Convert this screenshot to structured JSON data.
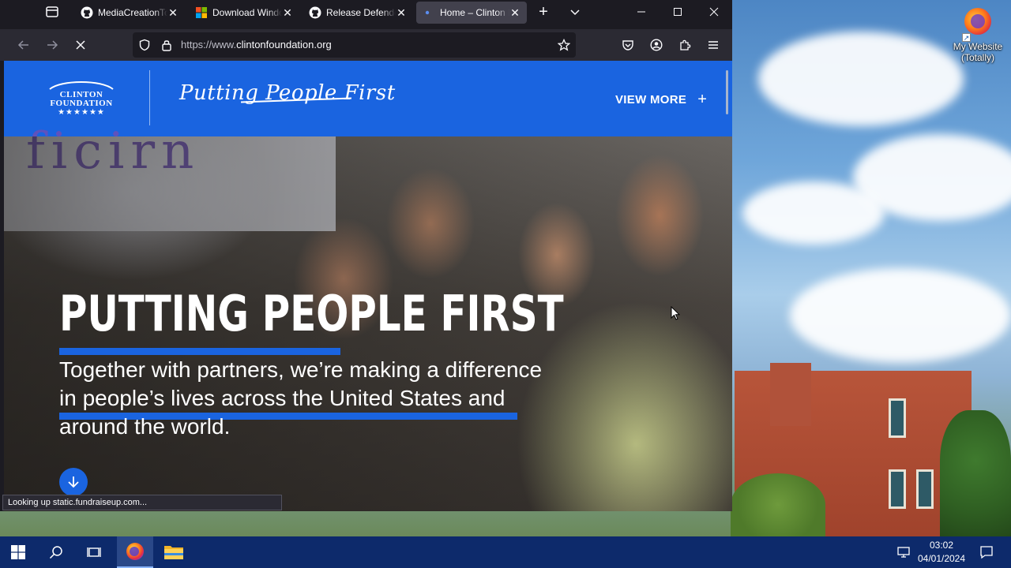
{
  "browser": {
    "tabs": [
      {
        "title": "MediaCreationTool",
        "icon": "github-icon",
        "active": false
      },
      {
        "title": "Download Windows",
        "icon": "windows-icon",
        "active": false
      },
      {
        "title": "Release Defender",
        "icon": "github-icon",
        "active": false
      },
      {
        "title": "Home – Clinton Foundation",
        "icon": "loading-dot-icon",
        "active": true
      }
    ],
    "url_prefix": "https://www.",
    "url_host": "clintonfoundation.org",
    "status_text": "Looking up static.fundraiseup.com..."
  },
  "site": {
    "logo_line1": "CLINTON",
    "logo_line2": "FOUNDATION",
    "logo_stars": "★★★★★★",
    "tagline": "Putting People First",
    "view_more": "VIEW MORE",
    "view_more_icon": "+",
    "hero_banner": "ficirn",
    "hero_title": "PUTTING PEOPLE FIRST",
    "hero_subtitle": "Together with partners, we’re making a difference in people’s lives across the United States and around the world."
  },
  "desktop": {
    "icon_label": "My Website (Totally)"
  },
  "taskbar": {
    "time": "03:02",
    "date": "04/01/2024"
  },
  "colors": {
    "brand_blue": "#1a64e0",
    "browser_dark": "#1c1b22",
    "taskbar": "#0d2a6b"
  }
}
